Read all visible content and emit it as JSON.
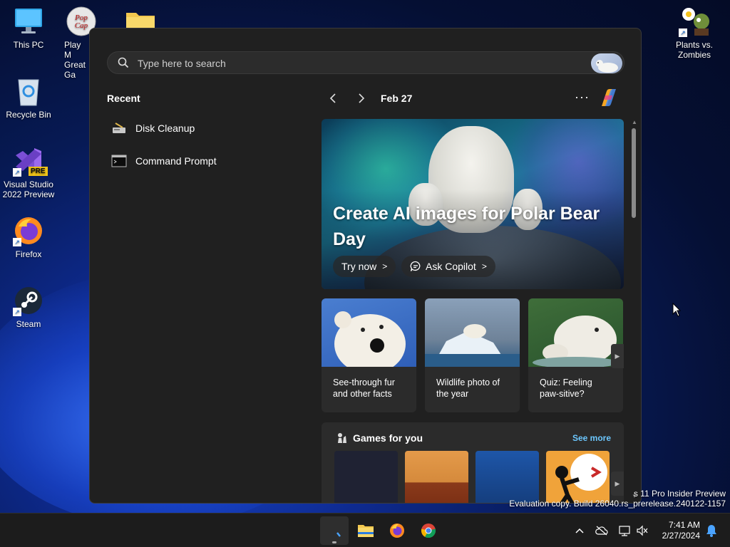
{
  "desktop": {
    "icons": [
      {
        "label": "This PC"
      },
      {
        "label": "Recycle Bin"
      },
      {
        "label": "Visual Studio 2022 Preview",
        "badge": "PRE"
      },
      {
        "label": "Firefox"
      },
      {
        "label": "Steam"
      },
      {
        "label": "Play M Great Ga",
        "logo_text": "Pop Cap"
      },
      {
        "label": "Plants vs. Zombies"
      }
    ]
  },
  "start": {
    "search_placeholder": "Type here to search",
    "recent_title": "Recent",
    "recent_items": [
      {
        "label": "Disk Cleanup",
        "icon": "disk-cleanup-icon"
      },
      {
        "label": "Command Prompt",
        "icon": "command-prompt-icon"
      }
    ],
    "date": "Feb 27",
    "more": "···",
    "hero": {
      "title": "Create AI images for Polar Bear Day",
      "try_now": "Try now",
      "ask_copilot": "Ask Copilot"
    },
    "cards": [
      {
        "caption": "See-through fur and other facts"
      },
      {
        "caption": "Wildlife photo of the year"
      },
      {
        "caption": "Quiz: Feeling paw-sitive?"
      }
    ],
    "games": {
      "title": "Games for you",
      "see_more": "See more"
    }
  },
  "watermark": {
    "line1": "s 11 Pro Insider Preview",
    "line2": "Evaluation copy. Build 26040.rs_prerelease.240122-1157"
  },
  "taskbar": {
    "time": "7:41 AM",
    "date": "2/27/2024"
  },
  "colors": {
    "panel_bg": "#202020",
    "card_bg": "#2b2b2b",
    "accent_link": "#6cc7ff",
    "taskbar_bg": "#1c1c1c"
  }
}
